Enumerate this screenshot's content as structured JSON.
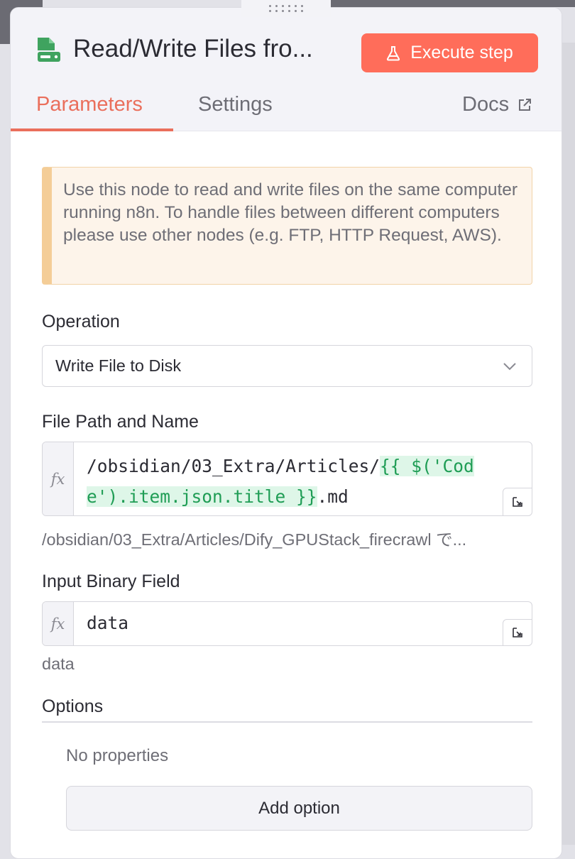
{
  "node": {
    "title": "Read/Write Files fro...",
    "execute_label": "Execute step"
  },
  "tabs": [
    {
      "label": "Parameters",
      "active": true
    },
    {
      "label": "Settings",
      "active": false
    },
    {
      "label": "Docs",
      "active": false
    }
  ],
  "notice": {
    "text": "Use this node to read and write files on the same computer running n8n. To handle files between different computers please use other nodes (e.g. FTP, HTTP Request, AWS)."
  },
  "operation": {
    "label": "Operation",
    "value": "Write File to Disk"
  },
  "file_path": {
    "label": "File Path and Name",
    "prefix": "/obsidian/03_Extra/Articles/",
    "expr_line1": "{{ $('Cod",
    "expr_line2": "e').item.json.title }}",
    "suffix": ".md",
    "resolved": "/obsidian/03_Extra/Articles/Dify_GPUStack_firecrawl で..."
  },
  "binary_field": {
    "label": "Input Binary Field",
    "value": "data",
    "resolved": "data"
  },
  "options": {
    "label": "Options",
    "empty_text": "No properties",
    "add_label": "Add option"
  },
  "colors": {
    "accent": "#ff6d5a",
    "expression_bg": "#def6e8",
    "expression_fg": "#1f9d55",
    "notice_bg": "#fdf4ea"
  },
  "icons": {
    "node": "file-disk-icon",
    "execute": "flask-icon",
    "docs": "external-link-icon",
    "fx": "fx-icon",
    "expand": "expand-icon",
    "dropdown": "chevron-down-icon"
  }
}
